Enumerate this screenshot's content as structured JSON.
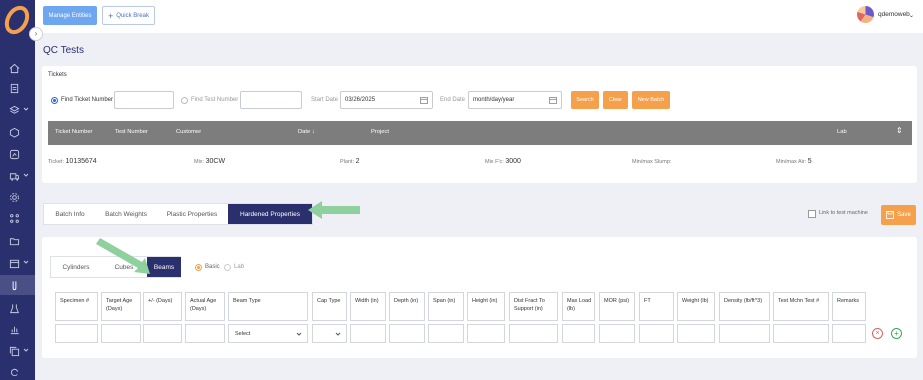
{
  "topbar": {
    "manage_label": "Manage Entities",
    "quick_label": "Quick Break",
    "username": "qdemoweb"
  },
  "page_title": "QC Tests",
  "tickets": {
    "label": "Tickets",
    "find_ticket_label": "Find Ticket Number",
    "find_test_label": "Find Test Number",
    "start_date_label": "Start Date",
    "start_date_value": "03/26/2025",
    "end_date_label": "End Date",
    "end_date_value": "month/day/year",
    "search_label": "Search",
    "clear_label": "Clear",
    "new_batch_label": "New Batch",
    "columns": [
      "Ticket Number",
      "Test Number",
      "Customer",
      "Date ↓",
      "Project",
      "Lab"
    ],
    "row": {
      "ticket_prefix": "Ticket:",
      "ticket_value": "10135674",
      "mix_prefix": "Mix:",
      "mix_value": "30CW",
      "plant_prefix": "Plant:",
      "plant_value": "2",
      "mixfc_prefix": "Mix F'c:",
      "mixfc_value": "3000",
      "slump_prefix": "Min/max Slump:",
      "slump_value": "",
      "air_prefix": "Min/max Air:",
      "air_value": "5"
    }
  },
  "tabs": [
    "Batch Info",
    "Batch Weights",
    "Plastic Properties",
    "Hardened Properties"
  ],
  "link_machine_label": "Link to test machine",
  "save_label": "Save",
  "subtabs": [
    "Cylinders",
    "Cubes",
    "Beams"
  ],
  "mode": {
    "basic": "Basic",
    "lab": "Lab"
  },
  "beam_columns": [
    "Specimen #",
    "Target Age (Days)",
    "+/- (Days)",
    "Actual Age (Days)",
    "Beam Type",
    "Cap Type",
    "Width (in)",
    "Depth (in)",
    "Span (in)",
    "Height (in)",
    "Dist Fract To Support (in)",
    "Max Load (lb)",
    "MOR (psi)",
    "FT",
    "Weight (lb)",
    "Density (lb/ft^3)",
    "Test Mchn Test #",
    "Remarks"
  ],
  "beam_type_select": "Select",
  "colors": {
    "sidebar": "#2a2f6e",
    "accent_orange": "#f5a04a",
    "manage_blue": "#6ea6f0",
    "arrow_green": "#8fd19e"
  }
}
